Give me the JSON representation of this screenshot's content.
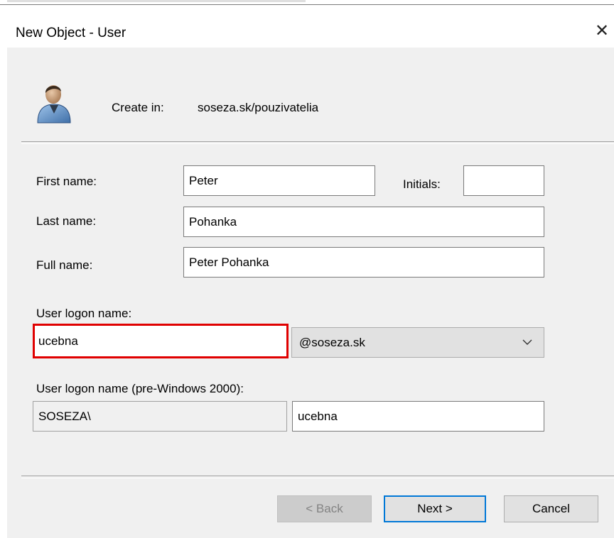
{
  "window": {
    "title": "New Object - User",
    "close_glyph": "✕"
  },
  "header": {
    "create_in_label": "Create in:",
    "create_in_value": "soseza.sk/pouzivatelia",
    "icon": "user-icon"
  },
  "form": {
    "first_name_label": "First name:",
    "first_name_value": "Peter",
    "initials_label": "Initials:",
    "initials_value": "",
    "last_name_label": "Last name:",
    "last_name_value": "Pohanka",
    "full_name_label": "Full name:",
    "full_name_value": "Peter Pohanka",
    "logon_label": "User logon name:",
    "logon_value": "ucebna",
    "domain_suffix": "@soseza.sk",
    "pre2000_label": "User logon name (pre-Windows 2000):",
    "pre2000_domain": "SOSEZA\\",
    "pre2000_value": "ucebna"
  },
  "buttons": {
    "back": "< Back",
    "next": "Next >",
    "cancel": "Cancel"
  },
  "colors": {
    "highlight": "#e00000",
    "default_button_border": "#0078d7",
    "dialog_bg": "#f0f0f0"
  }
}
